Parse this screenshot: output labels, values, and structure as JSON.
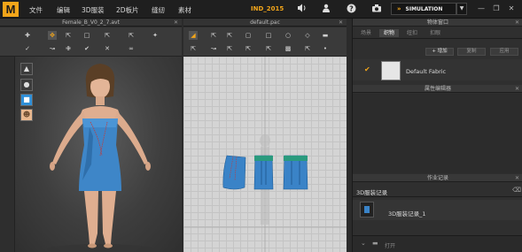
{
  "app": {
    "logo_letter": "M",
    "menu": [
      "文件",
      "编辑",
      "3D服装",
      "2D板片",
      "缝纫",
      "素材"
    ],
    "project_name": "IND_2015",
    "simulation_label": "SIMULATION",
    "accent_color": "#f2a51a"
  },
  "window3d": {
    "title": "Female_B_V0_2_7.avt"
  },
  "window2d": {
    "title": "default.pac"
  },
  "object_browser": {
    "title": "物体窗口",
    "tabs": [
      "场景",
      "织物",
      "纽扣",
      "扣眼"
    ],
    "active_tab_index": 1,
    "buttons": {
      "add": "+ 增加",
      "copy": "复制",
      "apply": "应用"
    },
    "fabrics": [
      {
        "name": "Default Fabric",
        "selected": true,
        "swatch_color": "#e6e6e6"
      }
    ]
  },
  "property_editor": {
    "title": "属性编辑器"
  },
  "history": {
    "title": "作业记录",
    "header": "3D服装记录",
    "items": [
      {
        "label": "3D服装记录_1"
      }
    ]
  },
  "footer": {
    "label": "打开"
  },
  "icons": {
    "volume": "volume-icon",
    "user": "user-icon",
    "help": "help-icon",
    "camera": "camera-icon",
    "window_minimize": "minimize-icon",
    "window_restore": "restore-icon",
    "window_close": "close-icon"
  }
}
